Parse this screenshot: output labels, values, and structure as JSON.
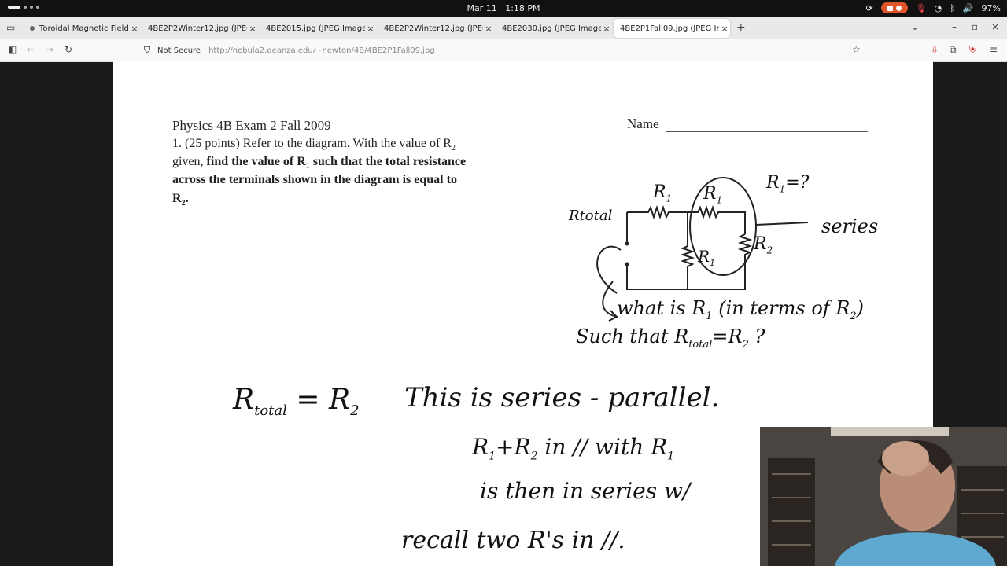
{
  "system": {
    "date": "Mar 11",
    "time": "1:18 PM",
    "battery": "97%"
  },
  "tabs": [
    {
      "label": "Toroidal Magnetic Field"
    },
    {
      "label": "4BE2P2Winter12.jpg (JPEG I"
    },
    {
      "label": "4BE2015.jpg (JPEG Image, 8"
    },
    {
      "label": "4BE2P2Winter12.jpg (JPEG I"
    },
    {
      "label": "4BE2030.jpg (JPEG Image, 8"
    },
    {
      "label": "4BE2P1Fall09.jpg (JPEG Ima"
    }
  ],
  "navbar": {
    "security": "Not Secure",
    "url": "http://nebula2.deanza.edu/~newton/4B/4BE2P1Fall09.jpg"
  },
  "exam": {
    "title": "Physics 4B Exam 2   Fall 2009",
    "name_label": "Name",
    "q_line1": "1. (25 points) Refer to the diagram. With the value of R",
    "q_line1_sub": "2",
    "q_line2a": "given, ",
    "q_line2b": "find the value of R",
    "q_line2_sub": "1",
    "q_line2c": " such that the total resistance",
    "q_line3": "across the terminals shown in the diagram is equal to",
    "q_line4": "R",
    "q_line4_sub": "2",
    "q_line4_end": "."
  },
  "annotations": {
    "r1_top": "R",
    "r1_question": "R",
    "r1_q_tail": "=?",
    "series": "series",
    "rtotal": "Rtotal",
    "r1_mid": "R",
    "r2_side": "R",
    "what_is": "what is R",
    "in_terms": "(in terms of R",
    "such_that": "Such that R",
    "total_sub": "total",
    "equals_r2": "=R",
    "qmark": "?",
    "eq_left": "R",
    "eq_total": "total",
    "eq_right": "= R",
    "series_parallel": "This is series - parallel.",
    "line2": "R",
    "line2_rest": "+R",
    "line2_tail": " in // with R",
    "line3": "is then in series w/",
    "line4": "recall two R's in //."
  }
}
